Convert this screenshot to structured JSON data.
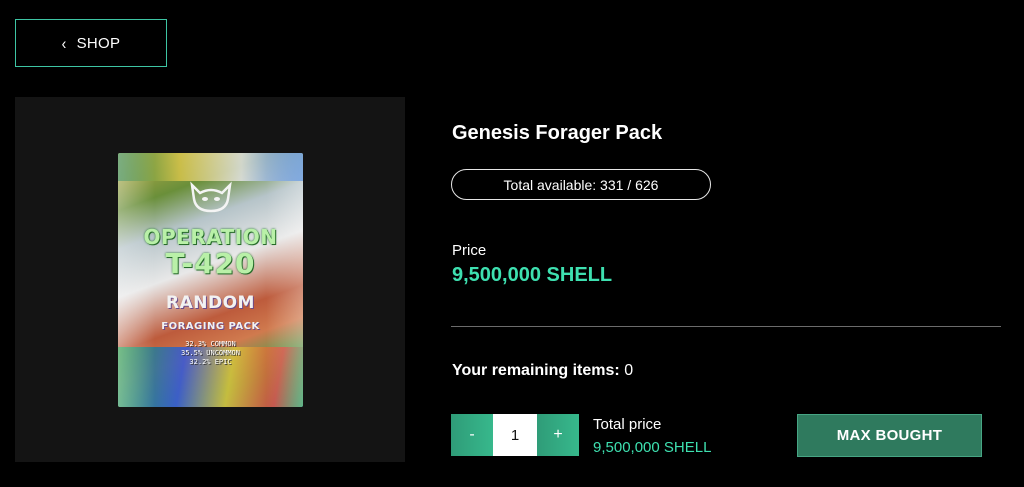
{
  "nav": {
    "back_label": "SHOP",
    "back_icon": "chevron-left-icon"
  },
  "product": {
    "name": "Genesis Forager Pack",
    "availability": "Total available: 331 / 626",
    "price_label": "Price",
    "price_value": "9,500,000 SHELL",
    "remaining_label": "Your remaining items:",
    "remaining_value": "0"
  },
  "pack_art": {
    "line1": "OPERATION",
    "line2": "T-420",
    "line3": "RANDOM",
    "line4": "FORAGING PACK",
    "odds": [
      "32.3% COMMON",
      "35.5% UNCOMMON",
      "32.2% EPIC"
    ]
  },
  "purchase": {
    "decrement_label": "-",
    "quantity": "1",
    "increment_label": "+",
    "total_label": "Total price",
    "total_value": "9,500,000 SHELL",
    "action_label": "MAX BOUGHT"
  },
  "colors": {
    "accent": "#3ee0b0",
    "button": "#2f7a5e",
    "border": "#3ec5a4"
  }
}
